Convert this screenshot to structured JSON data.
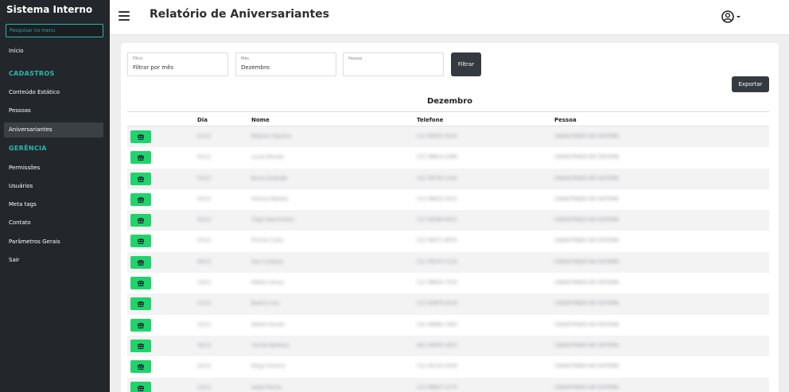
{
  "sidebar": {
    "brand": "Sistema Interno",
    "search_placeholder": "Pesquisar no menu",
    "items": {
      "inicio": "Início",
      "cadastros_header": "CADASTROS",
      "conteudo": "Conteúdo Estático",
      "pessoas": "Pessoas",
      "aniversariantes": "Aniversariantes",
      "gerencia_header": "GERÊNCIA",
      "permissoes": "Permissões",
      "usuarios": "Usuários",
      "meta_tags": "Meta tags",
      "contato": "Contato",
      "parametros": "Parâmetros Gerais",
      "sair": "Sair"
    },
    "active_item": "Aniversariantes"
  },
  "header": {
    "title": "Relatório de Aniversariantes"
  },
  "filters": {
    "filtro": {
      "label": "Filtro",
      "value": "Filtrar por mês"
    },
    "mes": {
      "label": "Mês",
      "value": "Dezembro"
    },
    "pessoa": {
      "label": "Pessoa",
      "value": ""
    },
    "filter_button": "Filtrar",
    "export_button": "Exportar"
  },
  "report": {
    "month_title": "Dezembro",
    "columns": {
      "dia": "Dia",
      "nome": "Nome",
      "telefone": "Telefone",
      "pessoa": "Pessoa"
    },
    "rows": [
      {
        "dia": "01/12",
        "nome": "Roberto Siqueira",
        "telefone": "(11) 99452-3010",
        "pessoa": "CADASTRADO NO SISTEMA"
      },
      {
        "dia": "01/12",
        "nome": "Lucas Moraes",
        "telefone": "(21) 98814-2286",
        "pessoa": "CADASTRADO NO SISTEMA"
      },
      {
        "dia": "02/12",
        "nome": "Bruna Andrade",
        "telefone": "(31) 99745-1192",
        "pessoa": "CADASTRADO NO SISTEMA"
      },
      {
        "dia": "03/12",
        "nome": "Vinícius Batista",
        "telefone": "(11) 96632-4415",
        "pessoa": "CADASTRADO NO SISTEMA"
      },
      {
        "dia": "05/12",
        "nome": "Tiago Nascimento",
        "telefone": "(11) 94586-6021",
        "pessoa": "CADASTRADO NO SISTEMA"
      },
      {
        "dia": "07/12",
        "nome": "Priscila Costa",
        "telefone": "(21) 99371-8035",
        "pessoa": "CADASTRADO NO SISTEMA"
      },
      {
        "dia": "09/12",
        "nome": "Davi Cardoso",
        "telefone": "(11) 95570-7124",
        "pessoa": "CADASTRADO NO SISTEMA"
      },
      {
        "dia": "10/12",
        "nome": "Helena Souza",
        "telefone": "(11) 98944-7530",
        "pessoa": "CADASTRADO NO SISTEMA"
      },
      {
        "dia": "12/12",
        "nome": "Beatriz Lins",
        "telefone": "(11) 93876-4218",
        "pessoa": "CADASTRADO NO SISTEMA"
      },
      {
        "dia": "15/12",
        "nome": "Rafael Gomes",
        "telefone": "(31) 99682-7463",
        "pessoa": "CADASTRADO NO SISTEMA"
      },
      {
        "dia": "18/12",
        "nome": "Camila Barbosa",
        "telefone": "(81) 99609-1833",
        "pessoa": "CADASTRADO NO SISTEMA"
      },
      {
        "dia": "20/12",
        "nome": "Diego Ferreira",
        "telefone": "(11) 95124-3209",
        "pessoa": "CADASTRADO NO SISTEMA"
      },
      {
        "dia": "23/12",
        "nome": "Isabel Rocha",
        "telefone": "(21) 98657-2175",
        "pessoa": "CADASTRADO NO SISTEMA"
      }
    ]
  },
  "colors": {
    "accent": "#2bb7b1",
    "gift_button": "#20d46b",
    "sidebar_bg": "#23272b"
  },
  "icons": {
    "menu": "hamburger-icon",
    "user": "user-circle-icon",
    "gift": "gift-icon"
  }
}
